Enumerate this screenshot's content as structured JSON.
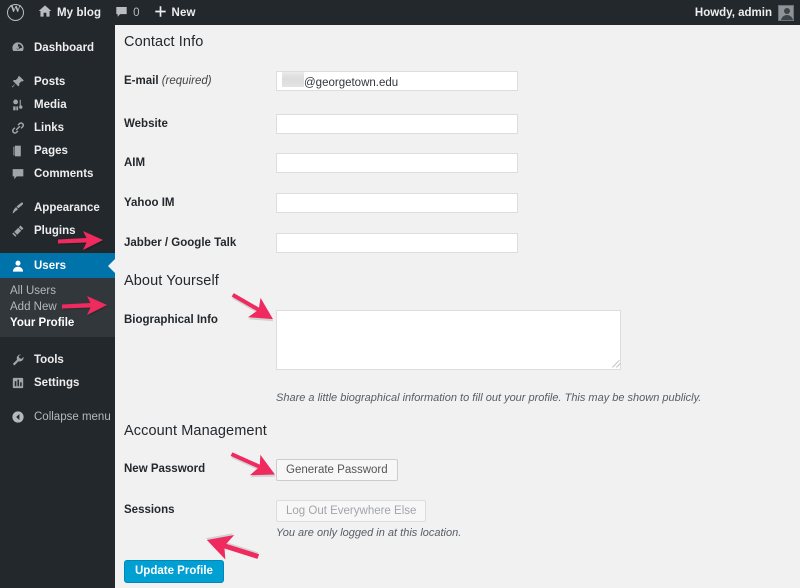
{
  "adminbar": {
    "logo_icon": "wordpress-logo-icon",
    "site_icon": "home-icon",
    "site_name": "My blog",
    "comments_icon": "comment-bubble-icon",
    "comments_count": "0",
    "new_icon": "plus-icon",
    "new_label": "New",
    "howdy": "Howdy, admin",
    "avatar_icon": "user-avatar-icon"
  },
  "sidebar": {
    "items": [
      {
        "label": "Dashboard",
        "icon": "dashboard-icon",
        "key": "dashboard"
      },
      {
        "label": "Posts",
        "icon": "pin-icon",
        "key": "posts"
      },
      {
        "label": "Media",
        "icon": "media-icon",
        "key": "media"
      },
      {
        "label": "Links",
        "icon": "link-icon",
        "key": "links"
      },
      {
        "label": "Pages",
        "icon": "pages-icon",
        "key": "pages"
      },
      {
        "label": "Comments",
        "icon": "comment-bubble-icon",
        "key": "comments"
      },
      {
        "label": "Appearance",
        "icon": "paintbrush-icon",
        "key": "appearance"
      },
      {
        "label": "Plugins",
        "icon": "plug-icon",
        "key": "plugins"
      },
      {
        "label": "Users",
        "icon": "user-icon",
        "key": "users"
      },
      {
        "label": "Tools",
        "icon": "wrench-icon",
        "key": "tools"
      },
      {
        "label": "Settings",
        "icon": "settings-sliders-icon",
        "key": "settings"
      }
    ],
    "users_submenu": [
      {
        "label": "All Users",
        "current": false
      },
      {
        "label": "Add New",
        "current": false
      },
      {
        "label": "Your Profile",
        "current": true
      }
    ],
    "collapse": {
      "label": "Collapse menu",
      "icon": "collapse-arrow-icon"
    },
    "active_color": "#0073aa",
    "background_color": "#23282d",
    "submenu_background_color": "#32373c"
  },
  "content": {
    "contact_info": {
      "title": "Contact Info",
      "fields": [
        {
          "label": "E-mail",
          "required_note": "(required)",
          "value": "@georgetown.edu",
          "redacted": true,
          "placeholder": ""
        },
        {
          "label": "Website",
          "required_note": "",
          "value": "",
          "redacted": false,
          "placeholder": ""
        },
        {
          "label": "AIM",
          "required_note": "",
          "value": "",
          "redacted": false,
          "placeholder": ""
        },
        {
          "label": "Yahoo IM",
          "required_note": "",
          "value": "",
          "redacted": false,
          "placeholder": ""
        },
        {
          "label": "Jabber / Google Talk",
          "required_note": "",
          "value": "",
          "redacted": false,
          "placeholder": ""
        }
      ]
    },
    "about_yourself": {
      "title": "About Yourself",
      "bio_label": "Biographical Info",
      "bio_value": "",
      "bio_placeholder": "",
      "bio_help": "Share a little biographical information to fill out your profile. This may be shown publicly."
    },
    "account_management": {
      "title": "Account Management",
      "new_password_label": "New Password",
      "generate_password_label": "Generate Password",
      "sessions_label": "Sessions",
      "logout_everywhere_label": "Log Out Everywhere Else",
      "logout_everywhere_disabled": true,
      "sessions_help": "You are only logged in at this location."
    },
    "submit": {
      "update_profile_label": "Update Profile",
      "button_color": "#00a0d2"
    }
  },
  "annotations": {
    "arrow_color": "#ee2a5f",
    "arrows": [
      {
        "name": "arrow-to-users-menu",
        "points_at": "Users"
      },
      {
        "name": "arrow-to-your-profile",
        "points_at": "Your Profile"
      },
      {
        "name": "arrow-to-biographical-info",
        "points_at": "Biographical Info"
      },
      {
        "name": "arrow-to-generate-password",
        "points_at": "Generate Password"
      },
      {
        "name": "arrow-to-update-profile",
        "points_at": "Update Profile"
      }
    ]
  }
}
